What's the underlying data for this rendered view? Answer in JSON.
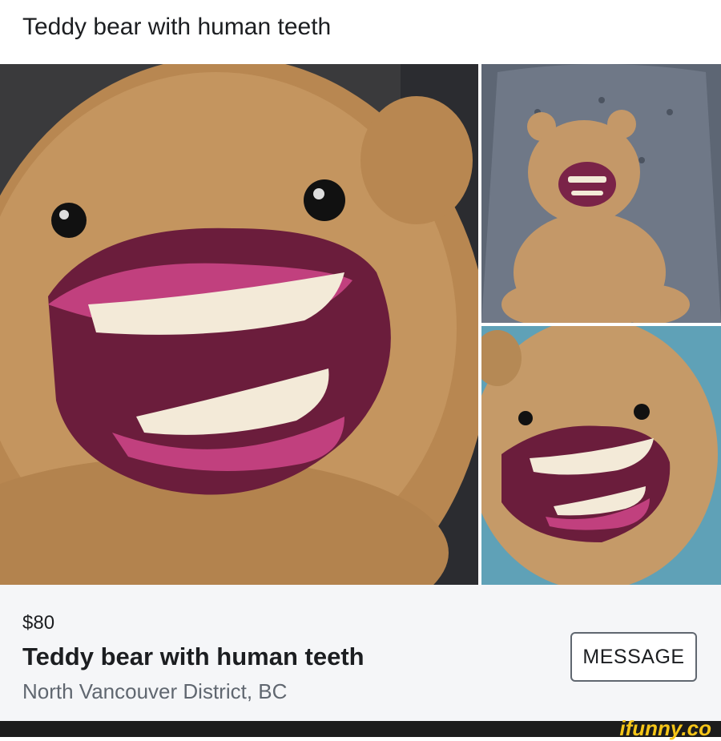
{
  "header": {
    "caption": "Teddy bear with human teeth"
  },
  "gallery": {
    "photos": [
      {
        "subject": "close-up of teddy bear face with human teeth"
      },
      {
        "subject": "teddy bear sitting in grey tufted chair"
      },
      {
        "subject": "teddy bear face with teeth, blue background"
      }
    ]
  },
  "listing": {
    "price": "$80",
    "title": "Teddy bear with human teeth",
    "location": "North Vancouver District, BC",
    "message_label": "MESSAGE"
  },
  "watermark": {
    "text": "ifunny.co",
    "color": "#f5c518"
  },
  "colors": {
    "fur": "#b98a52",
    "lips": "#8e2a5c",
    "teeth": "#f3ead8",
    "chair": "#6a7382"
  }
}
